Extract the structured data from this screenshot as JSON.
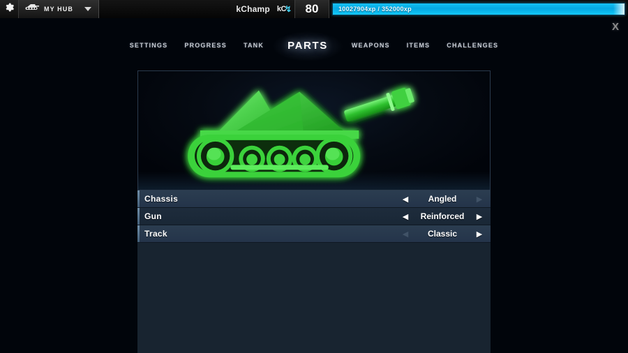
{
  "topbar": {
    "gear_icon": "gear-icon",
    "hub_icon": "tank-icon",
    "hub_label": "MY HUB",
    "hub_caret_icon": "chevron-down-icon",
    "player_name": "kChamp",
    "currency_label": "kC",
    "currency_bolt": "↯",
    "level": "80",
    "xp_text": "10027904xp / 352000xp",
    "xp_percent": 100
  },
  "close_button": {
    "label": "X"
  },
  "tabs": [
    {
      "label": "SETTINGS",
      "active": false
    },
    {
      "label": "PROGRESS",
      "active": false
    },
    {
      "label": "TANK",
      "active": false
    },
    {
      "label": "PARTS",
      "active": true
    },
    {
      "label": "WEAPONS",
      "active": false
    },
    {
      "label": "ITEMS",
      "active": false
    },
    {
      "label": "CHALLENGES",
      "active": false
    }
  ],
  "preview": {
    "tank_color": "#2ecc2e",
    "tank_glow": "#5dff5d",
    "background": "#050a12"
  },
  "parts": [
    {
      "label": "Chassis",
      "value": "Angled",
      "left_arrow": "◀",
      "right_arrow": "▶",
      "left_enabled": true,
      "right_enabled": false
    },
    {
      "label": "Gun",
      "value": "Reinforced",
      "left_arrow": "◀",
      "right_arrow": "▶",
      "left_enabled": true,
      "right_enabled": true
    },
    {
      "label": "Track",
      "value": "Classic",
      "left_arrow": "◀",
      "right_arrow": "▶",
      "left_enabled": false,
      "right_enabled": true
    }
  ],
  "colors": {
    "background": "#01050b",
    "panel": "#182430",
    "row_light": "#2b3d50",
    "row_dark": "#1e2c3c",
    "accent_cyan": "#0fc9f6",
    "tank_green": "#2ecc2e"
  }
}
